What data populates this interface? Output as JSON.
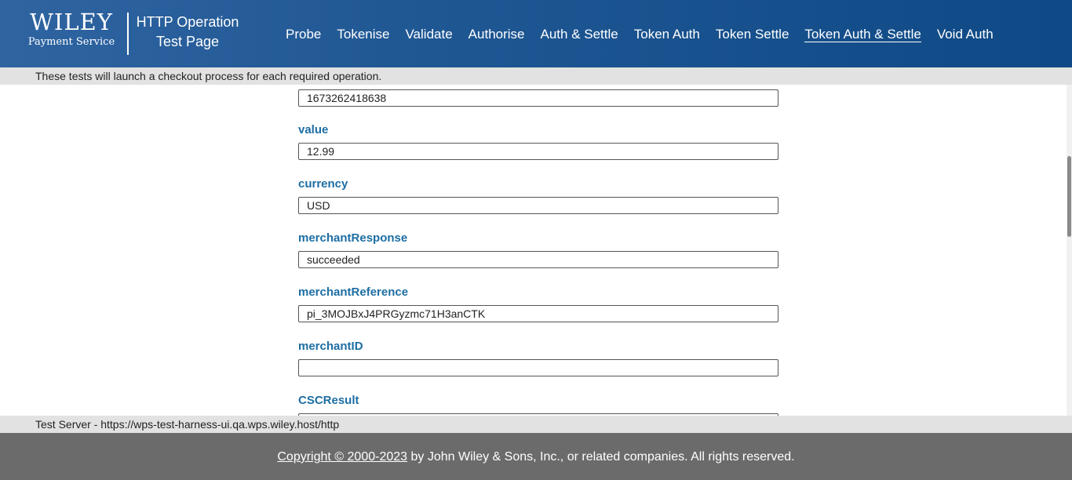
{
  "header": {
    "logo_main": "WILEY",
    "logo_sub": "Payment Service",
    "title_line1": "HTTP Operation",
    "title_line2": "Test Page",
    "nav": [
      {
        "label": "Probe"
      },
      {
        "label": "Tokenise"
      },
      {
        "label": "Validate"
      },
      {
        "label": "Authorise"
      },
      {
        "label": "Auth & Settle"
      },
      {
        "label": "Token Auth"
      },
      {
        "label": "Token Settle"
      },
      {
        "label": "Token Auth & Settle",
        "active": true
      },
      {
        "label": "Void Auth"
      }
    ],
    "colors": {
      "header_bg": "#1f5793",
      "label_color": "#1d6ea3",
      "footer_bg": "#6b6b6b"
    }
  },
  "info_bar": {
    "text": "These tests will launch a checkout process for each required operation."
  },
  "form": {
    "top_value": "1673262418638",
    "fields": [
      {
        "label": "value",
        "value": "12.99"
      },
      {
        "label": "currency",
        "value": "USD"
      },
      {
        "label": "merchantResponse",
        "value": "succeeded"
      },
      {
        "label": "merchantReference",
        "value": "pi_3MOJBxJ4PRGyzmc71H3anCTK"
      },
      {
        "label": "merchantID",
        "value": ""
      },
      {
        "label": "CSCResult",
        "value": ""
      }
    ]
  },
  "server_bar": {
    "text": "Test Server - https://wps-test-harness-ui.qa.wps.wiley.host/http"
  },
  "footer": {
    "copyright_link": "Copyright © 2000-2023",
    "copyright_rest": " by John Wiley & Sons, Inc., or related companies. All rights reserved."
  }
}
